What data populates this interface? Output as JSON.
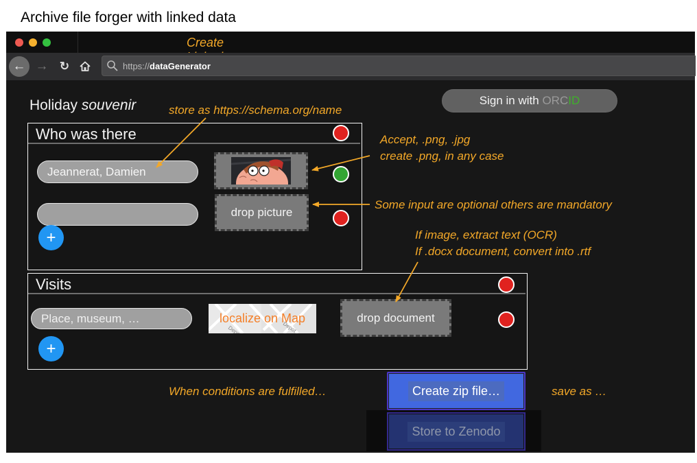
{
  "page": {
    "title": "Archive file forger with linked data"
  },
  "browser": {
    "tab_title": "Create Linked data",
    "url_prefix": "https://",
    "url_host": "dataGenerator",
    "icons": {
      "back": "←",
      "forward": "→",
      "reload": "↻",
      "home": "home-icon",
      "search": "search-icon"
    }
  },
  "app": {
    "title_plain": "Holiday ",
    "title_italic": "souvenir",
    "orcid_button": {
      "prefix": "Sign in with ",
      "orc": "ORC",
      "id": "ID"
    }
  },
  "sections": {
    "who": {
      "title": "Who was there",
      "status": "red",
      "rows": [
        {
          "name_value": "Jeannerat, Damien",
          "picture_state": "thumbnail",
          "status": "green"
        },
        {
          "name_value": "",
          "picture_label": "drop picture",
          "status": "red"
        }
      ],
      "add_label": "+"
    },
    "visits": {
      "title": "Visits",
      "status": "red",
      "rows": [
        {
          "place_placeholder": "Place, museum, …",
          "map_label": "localize on Map",
          "map_streets": [
            "Depot",
            "Depot"
          ],
          "document_label": "drop document",
          "status": "red"
        }
      ],
      "add_label": "+"
    }
  },
  "actions": {
    "create_zip": "Create zip file…",
    "store_zenodo": "Store to Zenodo"
  },
  "annotations": {
    "schema": "store as https://schema.org/name",
    "accept_line1": "Accept, .png, .jpg",
    "accept_line2": "create .png, in any case",
    "optional": "Some input are optional others are mandatory",
    "ocr_line1": "If image, extract text (OCR)",
    "ocr_line2": "If .docx document, convert into .rtf",
    "conditions": "When conditions are fulfilled…",
    "save_as": "save as …"
  },
  "colors": {
    "annotation": "#f3a828",
    "status_red": "#e0221f",
    "status_green": "#33a533",
    "add_button": "#2196f3",
    "zip_button": "#4168e0",
    "zenodo_button": "#243371",
    "orcid_green": "#3fb02a",
    "map_label": "#f47f28"
  }
}
